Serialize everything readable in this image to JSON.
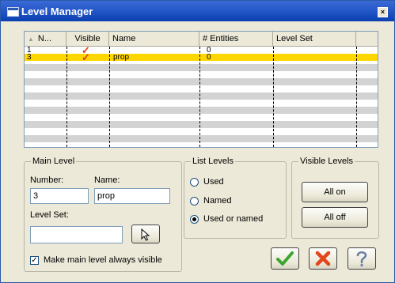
{
  "window": {
    "title": "Level Manager",
    "close_symbol": "×"
  },
  "table": {
    "columns": [
      "N...",
      "Visible",
      "Name",
      "# Entities",
      "Level Set"
    ],
    "rows": [
      {
        "number": "1",
        "visible": "✓",
        "name": "",
        "entities": "0",
        "level_set": ""
      },
      {
        "number": "3",
        "visible": "✓",
        "name": "prop",
        "entities": "0",
        "level_set": "",
        "selected": true
      }
    ],
    "selection_color": "#ffd700",
    "visible_check_color": "#e23a17"
  },
  "main_level": {
    "group_label": "Main Level",
    "number_label": "Number:",
    "number_value": "3",
    "name_label": "Name:",
    "name_value": "prop",
    "level_set_label": "Level Set:",
    "level_set_value": "",
    "pick_icon": "pointer-icon",
    "checkbox_label": "Make main level always visible",
    "checkbox_checked": true
  },
  "list_levels": {
    "group_label": "List Levels",
    "options": [
      "Used",
      "Named",
      "Used or named"
    ],
    "selected": "Used or named"
  },
  "visible_levels": {
    "group_label": "Visible Levels",
    "all_on_label": "All on",
    "all_off_label": "All off"
  },
  "dialog_buttons": {
    "ok_icon": "checkmark-icon",
    "cancel_icon": "x-icon",
    "help_icon": "question-icon",
    "ok_color": "#3ca62e",
    "cancel_color": "#e2461b",
    "help_color": "#6c7fa8"
  }
}
